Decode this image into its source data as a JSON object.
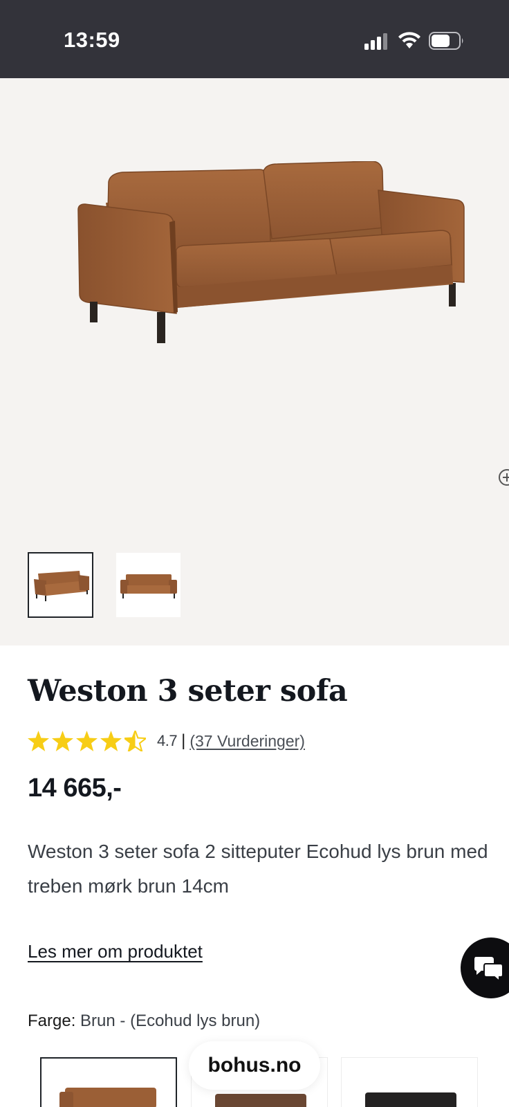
{
  "status_bar": {
    "time": "13:59",
    "icons": [
      "signal-icon",
      "wifi-icon",
      "battery-icon"
    ]
  },
  "gallery": {
    "main_image": "sofa-image",
    "zoom_icon": "zoom-icon",
    "thumbnails": [
      "sofa-thumbnail-angle",
      "sofa-thumbnail-front"
    ],
    "selected_thumbnail": 0
  },
  "product": {
    "title": "Weston 3 seter sofa",
    "rating": {
      "stars": 4.7,
      "max": 5,
      "value_text": "4.7",
      "separator": "|",
      "reviews_link": "(37 Vurderinger)"
    },
    "price": "14 665,-",
    "description": "Weston 3 seter sofa 2 sitteputer Ecohud lys brun med treben mørk brun 14cm",
    "read_more_link": "Les mer om produktet",
    "color": {
      "label": "Farge:",
      "value": "Brun - (Ecohud lys brun)",
      "options": [
        {
          "name": "brun-ecohud-lys-brun",
          "swatch_color": "#9b5f36",
          "selected": true
        },
        {
          "name": "brown-dark",
          "swatch_color": "#6a4733",
          "selected": false
        },
        {
          "name": "black",
          "swatch_color": "#242222",
          "selected": false
        }
      ]
    }
  },
  "chat": {
    "icon": "chat-bubbles-icon"
  },
  "browser": {
    "url": "bohus.no"
  },
  "colors": {
    "status_bar_bg": "#33333a",
    "hero_bg": "#f5f3f1",
    "star": "#f7cd16",
    "text_dark": "#14181f",
    "chat_button": "#0d0d10"
  }
}
